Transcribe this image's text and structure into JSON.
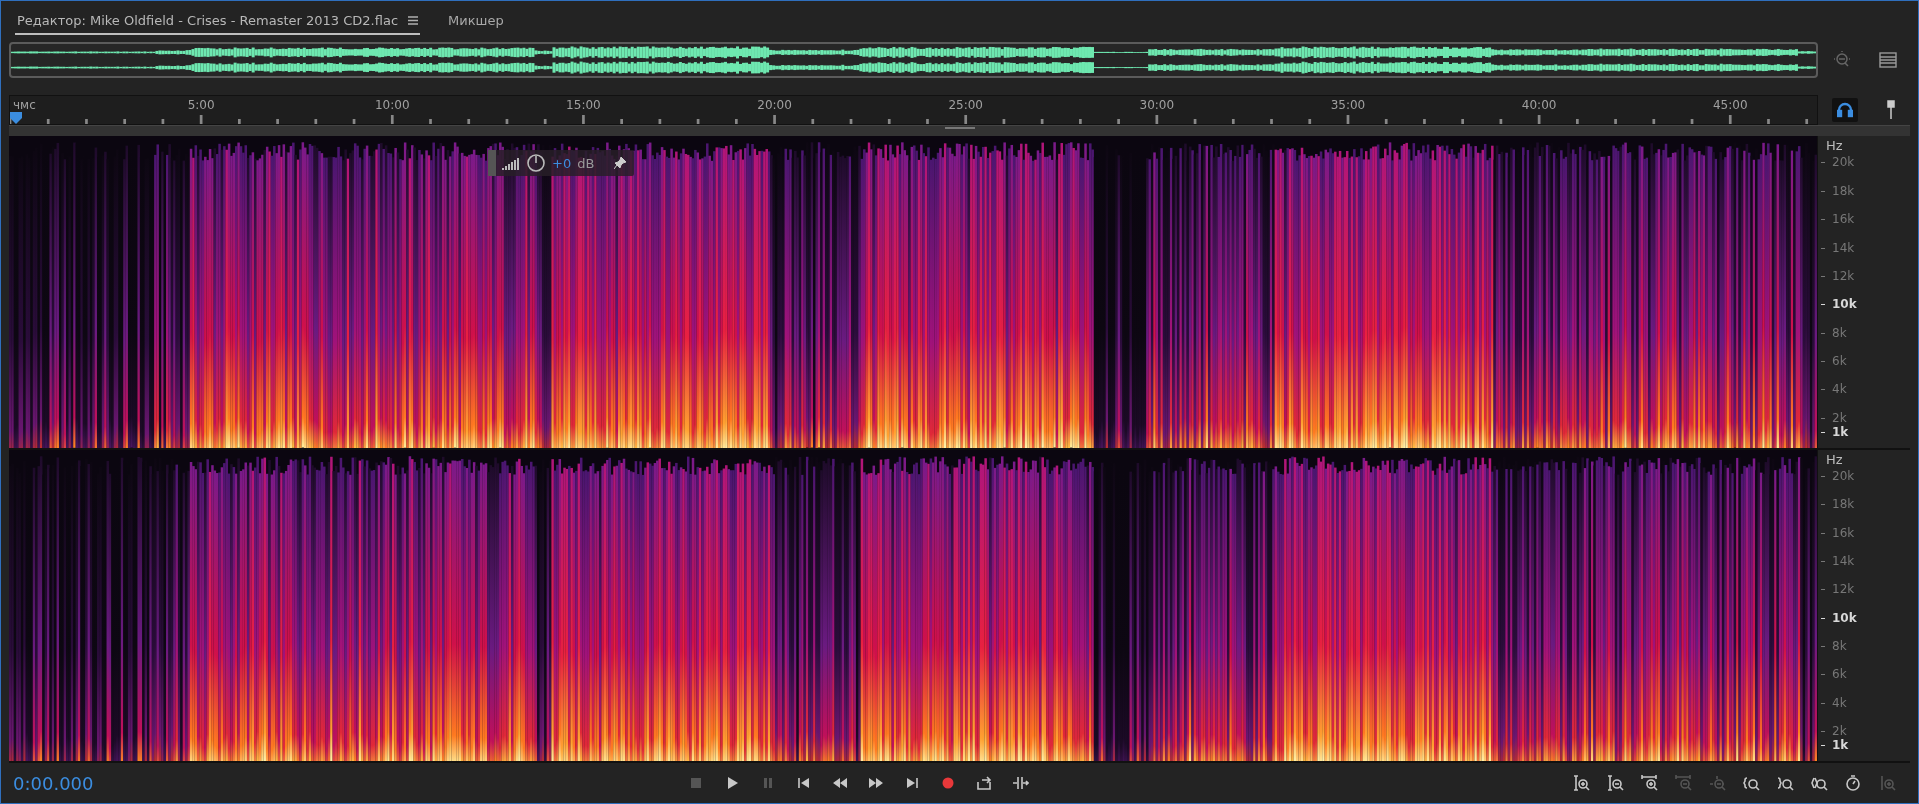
{
  "tabs": [
    {
      "label": "Редактор: Mike Oldfield - Crises - Remaster 2013 CD2.flac",
      "selected": true,
      "menu": true
    },
    {
      "label": "Микшер",
      "selected": false,
      "menu": false
    }
  ],
  "timeline": {
    "labels": [
      "чмс",
      "5:00",
      "10:00",
      "15:00",
      "20:00",
      "25:00",
      "30:00",
      "35:00",
      "40:00",
      "45:00"
    ]
  },
  "hud": {
    "value": "+0",
    "unit": "dB"
  },
  "channels": [
    {
      "unit": "Hz",
      "ticks": [
        {
          "label": "20k",
          "emphasized": false
        },
        {
          "label": "18k",
          "emphasized": false
        },
        {
          "label": "16k",
          "emphasized": false
        },
        {
          "label": "14k",
          "emphasized": false
        },
        {
          "label": "12k",
          "emphasized": false
        },
        {
          "label": "10k",
          "emphasized": true
        },
        {
          "label": "8k",
          "emphasized": false
        },
        {
          "label": "6k",
          "emphasized": false
        },
        {
          "label": "4k",
          "emphasized": false
        },
        {
          "label": "2k",
          "emphasized": false
        },
        {
          "label": "1k",
          "emphasized": true
        }
      ]
    },
    {
      "unit": "Hz",
      "ticks": [
        {
          "label": "20k",
          "emphasized": false
        },
        {
          "label": "18k",
          "emphasized": false
        },
        {
          "label": "16k",
          "emphasized": false
        },
        {
          "label": "14k",
          "emphasized": false
        },
        {
          "label": "12k",
          "emphasized": false
        },
        {
          "label": "10k",
          "emphasized": true
        },
        {
          "label": "8k",
          "emphasized": false
        },
        {
          "label": "6k",
          "emphasized": false
        },
        {
          "label": "4k",
          "emphasized": false
        },
        {
          "label": "2k",
          "emphasized": false
        },
        {
          "label": "1k",
          "emphasized": true
        }
      ]
    }
  ],
  "time": "0:00.000",
  "transport": [
    {
      "kind": "stop",
      "disabled": true
    },
    {
      "kind": "play",
      "disabled": false
    },
    {
      "kind": "pause",
      "disabled": true
    },
    {
      "kind": "to-start",
      "disabled": false
    },
    {
      "kind": "rewind",
      "disabled": false
    },
    {
      "kind": "forward",
      "disabled": false
    },
    {
      "kind": "to-end",
      "disabled": false
    },
    {
      "kind": "record",
      "disabled": false
    },
    {
      "kind": "loop",
      "disabled": false
    },
    {
      "kind": "skip",
      "disabled": false
    }
  ],
  "zoom_tools": [
    {
      "kind": "amp-in",
      "disabled": false
    },
    {
      "kind": "amp-out",
      "disabled": false
    },
    {
      "kind": "time-in",
      "disabled": false
    },
    {
      "kind": "time-out",
      "disabled": true
    },
    {
      "kind": "full",
      "disabled": true
    },
    {
      "kind": "left",
      "disabled": false
    },
    {
      "kind": "right",
      "disabled": false
    },
    {
      "kind": "both",
      "disabled": false
    },
    {
      "kind": "timer",
      "disabled": false
    },
    {
      "kind": "all-in",
      "disabled": true
    }
  ]
}
